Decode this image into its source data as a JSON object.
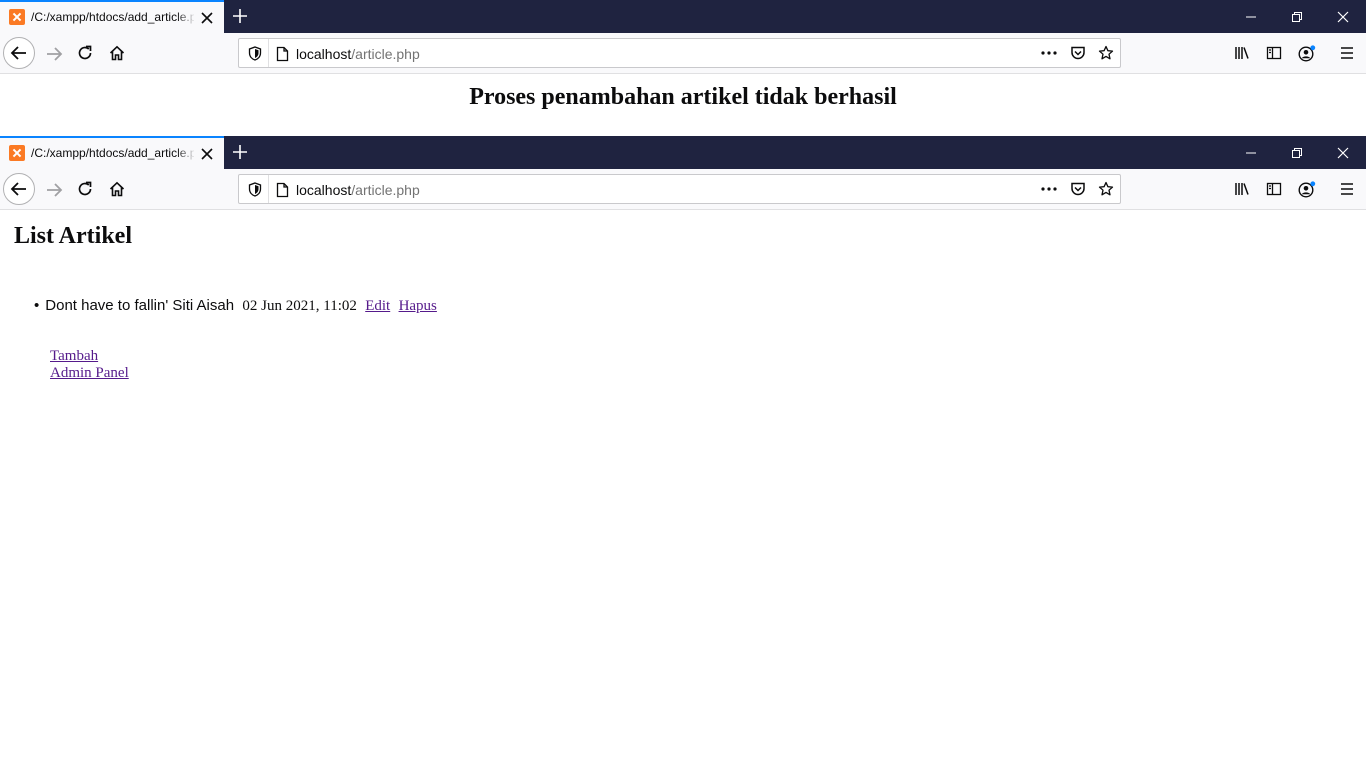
{
  "windows": [
    {
      "tab": {
        "title": "/C:/xampp/htdocs/add_article.php"
      },
      "url": {
        "host": "localhost",
        "path": "/article.php"
      },
      "page": {
        "heading": "Proses penambahan artikel tidak berhasil"
      }
    },
    {
      "tab": {
        "title": "/C:/xampp/htdocs/add_article.php"
      },
      "url": {
        "host": "localhost",
        "path": "/article.php"
      },
      "page": {
        "heading": "List Artikel",
        "articles": [
          {
            "title": "Dont have to fallin' Siti Aisah",
            "date": "02 Jun 2021, 11:02",
            "edit": "Edit",
            "delete": "Hapus"
          }
        ],
        "links": {
          "add": "Tambah",
          "admin": "Admin Panel"
        }
      }
    }
  ],
  "icons": [
    "xampp-favicon-icon",
    "close-tab-icon",
    "new-tab-icon",
    "minimize-icon",
    "restore-icon",
    "close-window-icon",
    "back-icon",
    "forward-icon",
    "reload-icon",
    "home-icon",
    "shield-icon",
    "page-icon",
    "more-icon",
    "pocket-icon",
    "bookmark-star-icon",
    "library-icon",
    "sidebar-icon",
    "account-icon",
    "menu-icon"
  ],
  "colors": {
    "tabstrip": "#1f2340",
    "active_tab_accent": "#0a84ff",
    "favicon": "#fb7a24",
    "visited_link": "#551a8b"
  }
}
